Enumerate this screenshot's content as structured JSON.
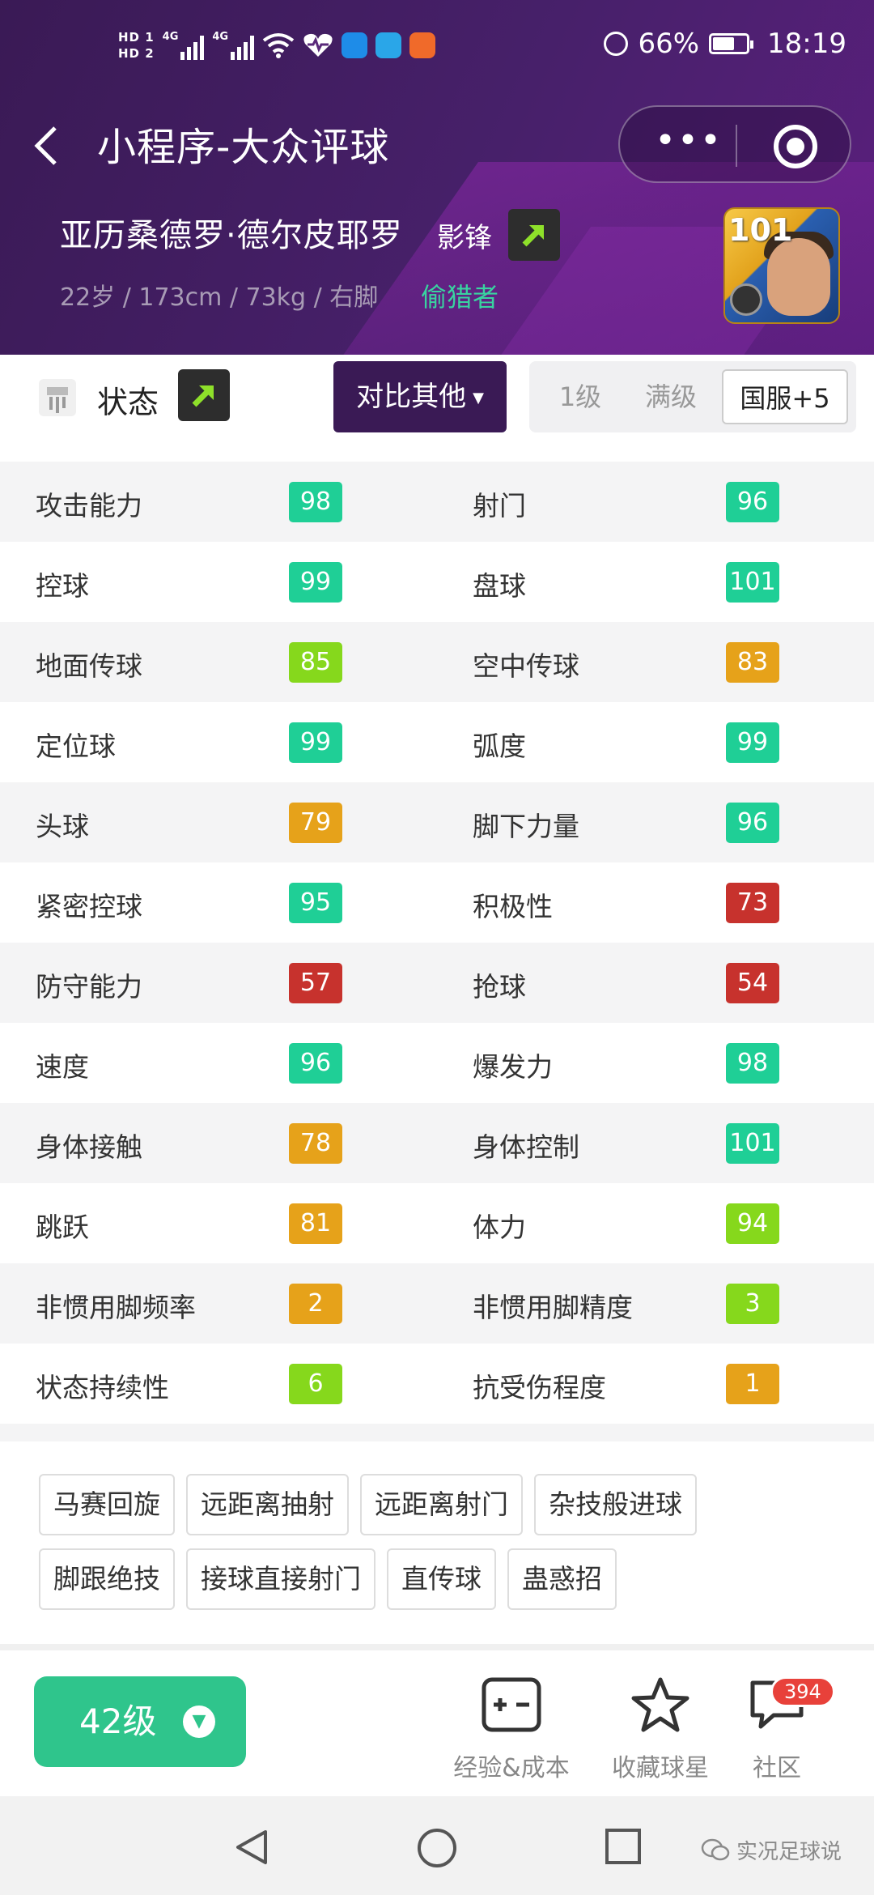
{
  "statusbar": {
    "hd1": "HD 1",
    "hd2": "HD 2",
    "net1": "4G",
    "net2": "4G",
    "battery": "66%",
    "time": "18:19"
  },
  "navbar": {
    "title": "小程序-大众评球"
  },
  "player": {
    "name": "亚历桑德罗·德尔皮耶罗",
    "position": "影锋",
    "info": "22岁 / 173cm / 73kg / 右脚",
    "style": "偷猎者",
    "card_rating": "101"
  },
  "status_row": {
    "label": "状态",
    "compare_label": "对比其他",
    "seg": [
      "1级",
      "满级",
      "国服+5"
    ]
  },
  "attributes": [
    {
      "l": "攻击能力",
      "lv": "98",
      "lc": "teal",
      "r": "射门",
      "rv": "96",
      "rc": "teal"
    },
    {
      "l": "控球",
      "lv": "99",
      "lc": "teal",
      "r": "盘球",
      "rv": "101",
      "rc": "teal"
    },
    {
      "l": "地面传球",
      "lv": "85",
      "lc": "lime",
      "r": "空中传球",
      "rv": "83",
      "rc": "orange"
    },
    {
      "l": "定位球",
      "lv": "99",
      "lc": "teal",
      "r": "弧度",
      "rv": "99",
      "rc": "teal"
    },
    {
      "l": "头球",
      "lv": "79",
      "lc": "orange",
      "r": "脚下力量",
      "rv": "96",
      "rc": "teal"
    },
    {
      "l": "紧密控球",
      "lv": "95",
      "lc": "teal",
      "r": "积极性",
      "rv": "73",
      "rc": "red"
    },
    {
      "l": "防守能力",
      "lv": "57",
      "lc": "red",
      "r": "抢球",
      "rv": "54",
      "rc": "red"
    },
    {
      "l": "速度",
      "lv": "96",
      "lc": "teal",
      "r": "爆发力",
      "rv": "98",
      "rc": "teal"
    },
    {
      "l": "身体接触",
      "lv": "78",
      "lc": "orange",
      "r": "身体控制",
      "rv": "101",
      "rc": "teal"
    },
    {
      "l": "跳跃",
      "lv": "81",
      "lc": "orange",
      "r": "体力",
      "rv": "94",
      "rc": "lime"
    },
    {
      "l": "非惯用脚频率",
      "lv": "2",
      "lc": "orange",
      "r": "非惯用脚精度",
      "rv": "3",
      "rc": "lime"
    },
    {
      "l": "状态持续性",
      "lv": "6",
      "lc": "lime",
      "r": "抗受伤程度",
      "rv": "1",
      "rc": "orange"
    }
  ],
  "skills": [
    [
      "马赛回旋",
      "远距离抽射",
      "远距离射门",
      "杂技般进球"
    ],
    [
      "脚跟绝技",
      "接球直接射门",
      "直传球",
      "蛊惑招"
    ]
  ],
  "bottombar": {
    "level": "42级",
    "exp_label": "经验&成本",
    "fav_label": "收藏球星",
    "community_label": "社区",
    "community_badge": "394"
  },
  "watermark": "实况足球说",
  "colors": {
    "header": "#47206a",
    "teal": "#1fcf96",
    "lime": "#86d81c",
    "orange": "#e6a21a",
    "red": "#c7322d",
    "accent_green": "#2fc58c"
  }
}
